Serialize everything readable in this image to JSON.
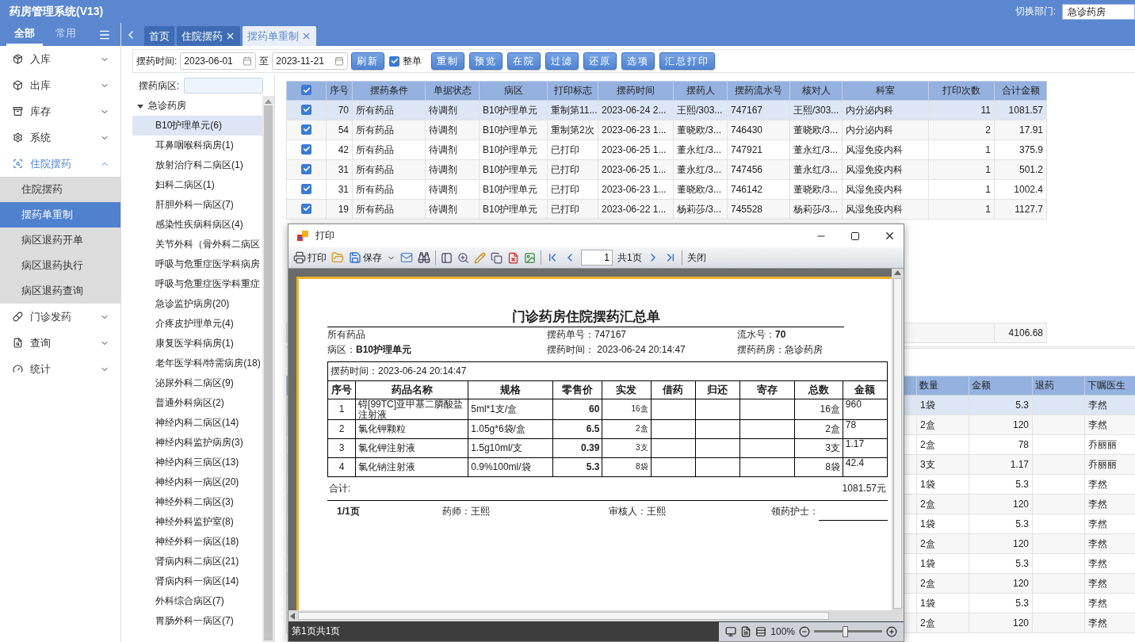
{
  "header": {
    "title": "药房管理系统(V13)",
    "dept_label": "切换部门:",
    "dept_value": "急诊药房"
  },
  "sidebar": {
    "tabs": [
      {
        "label": "全部",
        "selected": true
      },
      {
        "label": "常用",
        "selected": false
      }
    ],
    "items": [
      {
        "label": "入库",
        "expanded": false
      },
      {
        "label": "出库",
        "expanded": false
      },
      {
        "label": "库存",
        "expanded": false
      },
      {
        "label": "系统",
        "expanded": false
      },
      {
        "label": "住院摆药",
        "expanded": true,
        "children": [
          {
            "label": "住院摆药",
            "selected": false
          },
          {
            "label": "摆药单重制",
            "selected": true
          },
          {
            "label": "病区退药开单",
            "selected": false
          },
          {
            "label": "病区退药执行",
            "selected": false
          },
          {
            "label": "病区退药查询",
            "selected": false
          }
        ]
      },
      {
        "label": "门诊发药",
        "expanded": false
      },
      {
        "label": "查询",
        "expanded": false
      },
      {
        "label": "统计",
        "expanded": false
      }
    ]
  },
  "tabs": [
    {
      "label": "首页",
      "closable": false,
      "selected": false
    },
    {
      "label": "住院摆药",
      "closable": true,
      "selected": false
    },
    {
      "label": "摆药单重制",
      "closable": true,
      "selected": true
    }
  ],
  "toolbar": {
    "date_label": "摆药时间:",
    "date_from": "2023-06-01",
    "to_label": "至",
    "date_to": "2023-11-21",
    "refresh": "刷新",
    "whole_order": {
      "label": "整单",
      "checked": true
    },
    "buttons": [
      "重制",
      "预览",
      "在院",
      "过滤",
      "还原",
      "选项",
      "汇总打印"
    ]
  },
  "ward_filter": {
    "label": "摆药病区:"
  },
  "ward_tree": {
    "label": "急诊药房",
    "expanded": true,
    "children": [
      {
        "label": "B10护理单元(6)",
        "selected": true
      },
      {
        "label": "耳鼻咽喉科病房(1)",
        "selected": false
      },
      {
        "label": "放射治疗科二病区(1)",
        "selected": false
      },
      {
        "label": "妇科二病区(1)",
        "selected": false
      },
      {
        "label": "肝胆外科一病区(7)",
        "selected": false
      },
      {
        "label": "感染性疾病科病区(4)",
        "selected": false
      },
      {
        "label": "关节外科（骨外科二病区",
        "selected": false
      },
      {
        "label": "呼吸与危重症医学科病房",
        "selected": false
      },
      {
        "label": "呼吸与危重症医学科重症",
        "selected": false
      },
      {
        "label": "急诊监护病房(20)",
        "selected": false
      },
      {
        "label": "介疼皮护理单元(4)",
        "selected": false
      },
      {
        "label": "康复医学科病房(1)",
        "selected": false
      },
      {
        "label": "老年医学科/特需病房(18)",
        "selected": false
      },
      {
        "label": "泌尿外科二病区(9)",
        "selected": false
      },
      {
        "label": "普通外科病区(2)",
        "selected": false
      },
      {
        "label": "神经内科二病区(14)",
        "selected": false
      },
      {
        "label": "神经内科监护病房(3)",
        "selected": false
      },
      {
        "label": "神经内科三病区(13)",
        "selected": false
      },
      {
        "label": "神经内科一病区(20)",
        "selected": false
      },
      {
        "label": "神经外科二病区(3)",
        "selected": false
      },
      {
        "label": "神经外科监护室(8)",
        "selected": false
      },
      {
        "label": "神经外科一病区(18)",
        "selected": false
      },
      {
        "label": "肾病内科二病区(21)",
        "selected": false
      },
      {
        "label": "肾病内科一病区(14)",
        "selected": false
      },
      {
        "label": "外科综合病区(7)",
        "selected": false
      },
      {
        "label": "胃肠外科一病区(7)",
        "selected": false
      }
    ]
  },
  "orders": {
    "all_checked": true,
    "columns": [
      "序号",
      "摆药条件",
      "单据状态",
      "病区",
      "打印标志",
      "摆药时间",
      "摆药人",
      "摆药流水号",
      "核对人",
      "科室",
      "打印次数",
      "合计金额"
    ],
    "rows": [
      {
        "checked": true,
        "selected": true,
        "cells": [
          "70",
          "所有药品",
          "待调剂",
          "B10护理单元",
          "重制第11...",
          "2023-06-24 2...",
          "王熙/303...",
          "747167",
          "王熙/303...",
          "内分泌内科",
          "11",
          "1081.57"
        ]
      },
      {
        "checked": true,
        "selected": false,
        "cells": [
          "54",
          "所有药品",
          "待调剂",
          "B10护理单元",
          "重制第2次",
          "2023-06-23 1...",
          "董晓欧/3...",
          "746430",
          "董晓欧/3...",
          "内分泌内科",
          "2",
          "17.91"
        ]
      },
      {
        "checked": true,
        "selected": false,
        "cells": [
          "42",
          "所有药品",
          "待调剂",
          "B10护理单元",
          "已打印",
          "2023-06-25 1...",
          "董永红/3...",
          "747921",
          "董永红/3...",
          "风湿免疫内科",
          "1",
          "375.9"
        ]
      },
      {
        "checked": true,
        "selected": false,
        "cells": [
          "31",
          "所有药品",
          "待调剂",
          "B10护理单元",
          "已打印",
          "2023-06-25 1...",
          "董永红/3...",
          "747456",
          "董永红/3...",
          "风湿免疫内科",
          "1",
          "501.2"
        ]
      },
      {
        "checked": true,
        "selected": false,
        "cells": [
          "31",
          "所有药品",
          "待调剂",
          "B10护理单元",
          "已打印",
          "2023-06-23 1...",
          "董晓欧/3...",
          "746142",
          "董晓欧/3...",
          "风湿免疫内科",
          "1",
          "1002.4"
        ]
      },
      {
        "checked": true,
        "selected": false,
        "cells": [
          "19",
          "所有药品",
          "待调剂",
          "B10护理单元",
          "已打印",
          "2023-06-22 1...",
          "杨莉莎/3...",
          "745528",
          "杨莉莎/3...",
          "风湿免疫内科",
          "1",
          "1127.7"
        ]
      }
    ],
    "total": "4106.68"
  },
  "details": {
    "columns": [
      "数量",
      "金额",
      "退药",
      "下嘱医生"
    ],
    "rows": [
      {
        "selected": true,
        "quantity": "1袋",
        "amount": "5.3",
        "doctor": "李然"
      },
      {
        "selected": false,
        "quantity": "2盒",
        "amount": "120",
        "doctor": "李然"
      },
      {
        "selected": false,
        "quantity": "2盒",
        "amount": "78",
        "doctor": "乔丽丽"
      },
      {
        "selected": false,
        "quantity": "3支",
        "amount": "1.17",
        "doctor": "乔丽丽"
      },
      {
        "selected": false,
        "quantity": "1袋",
        "amount": "5.3",
        "doctor": "李然"
      },
      {
        "selected": false,
        "quantity": "2盒",
        "amount": "120",
        "doctor": "李然"
      },
      {
        "selected": false,
        "quantity": "1袋",
        "amount": "5.3",
        "doctor": "李然"
      },
      {
        "selected": false,
        "quantity": "2盒",
        "amount": "120",
        "doctor": "李然"
      },
      {
        "selected": false,
        "quantity": "1袋",
        "amount": "5.3",
        "doctor": "李然"
      },
      {
        "selected": false,
        "quantity": "2盒",
        "amount": "120",
        "doctor": "李然"
      },
      {
        "selected": false,
        "quantity": "1袋",
        "amount": "5.3",
        "doctor": "李然"
      },
      {
        "selected": false,
        "quantity": "2盒",
        "amount": "120",
        "doctor": "李然"
      }
    ]
  },
  "print_dialog": {
    "title": "打印",
    "toolbar": {
      "print": "打印",
      "save": "保存",
      "page": "1",
      "page_total": "共1页",
      "close": "关闭"
    },
    "report": {
      "title": "门诊药房住院摆药汇总单",
      "meta": [
        {
          "left": "所有药品",
          "middle": "摆药单号：747167",
          "right": "流水号：**70**"
        },
        {
          "left": "病区：**B10护理单元**",
          "middle": "摆药时间： 2023-06-24 20:14:47",
          "right": "摆药药房：急诊药房"
        }
      ],
      "caption": "摆药时间：2023-06-24 20:14:47",
      "columns": [
        "序号",
        "药品名称",
        "规格",
        "零售价",
        "实发",
        "借药",
        "归还",
        "寄存",
        "总数",
        "金额"
      ],
      "rows": [
        {
          "no": "1",
          "name": "锝[99TC]亚甲基二膦酸盐注射液",
          "spec": "5ml*1支/盒",
          "price": "60",
          "issued": "16盒",
          "total": "16盒",
          "amount": "960"
        },
        {
          "no": "2",
          "name": "氯化钾颗粒",
          "spec": "1.05g*6袋/盒",
          "price": "6.5",
          "issued": "2盒",
          "total": "2盒",
          "amount": "78"
        },
        {
          "no": "3",
          "name": "氯化钾注射液",
          "spec": "1.5g10ml/支",
          "price": "0.39",
          "issued": "3支",
          "total": "3支",
          "amount": "1.17"
        },
        {
          "no": "4",
          "name": "氯化钠注射液",
          "spec": "0.9%100ml/袋",
          "price": "5.3",
          "issued": "8袋",
          "total": "8袋",
          "amount": "42.4"
        }
      ],
      "sum_label": "合计:",
      "sum_value": "1081.57元",
      "footer": {
        "page": "1/1页",
        "pharmacist": "药师：王熙",
        "reviewer": "审核人：王熙",
        "nurse": "领药护士："
      }
    },
    "status": "第1页共1页",
    "zoom": {
      "reading": "100%",
      "level": 0.45
    }
  }
}
